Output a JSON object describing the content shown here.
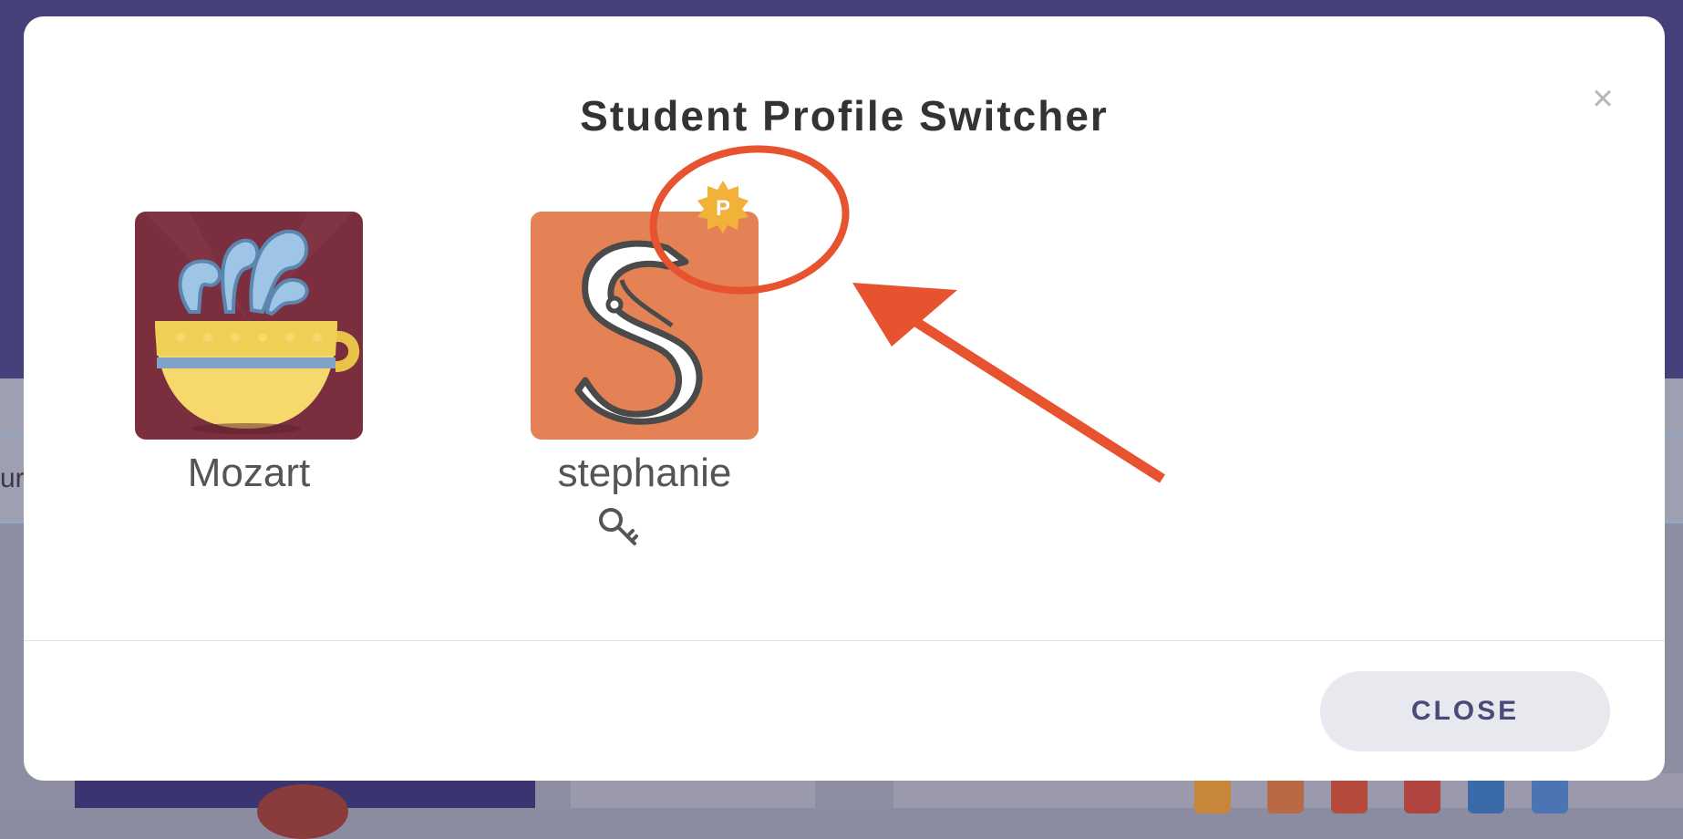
{
  "modal": {
    "title": "Student Profile Switcher",
    "close_x": "×",
    "close_button_label": "CLOSE"
  },
  "profiles": [
    {
      "name": "Mozart",
      "avatar_icon": "teacup-icon",
      "avatar_color": "#7a2e3e"
    },
    {
      "name": "stephanie",
      "avatar_icon": "letter-s-icon",
      "avatar_color": "#e48155",
      "badge_label": "P",
      "badge_icon": "premium-badge-icon",
      "key_icon": "key-icon"
    }
  ],
  "background": {
    "edge_text": "ur"
  },
  "annotation": {
    "color": "#e8532f",
    "shapes": [
      "circle-highlight",
      "arrow"
    ]
  }
}
